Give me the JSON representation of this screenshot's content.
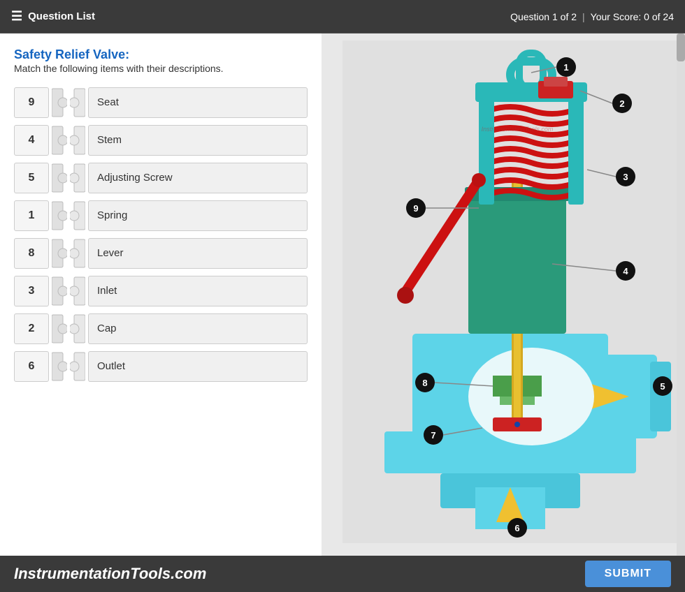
{
  "topBar": {
    "questionList": "Question List",
    "questionProgress": "Question 1 of 2",
    "score": "Your Score: 0 of 24"
  },
  "leftPanel": {
    "titleHighlight": "Safety Relief Valve:",
    "titleRest": "",
    "description": "Match the following items with their descriptions.",
    "rows": [
      {
        "number": "9",
        "label": "Seat"
      },
      {
        "number": "4",
        "label": "Stem"
      },
      {
        "number": "5",
        "label": "Adjusting Screw"
      },
      {
        "number": "1",
        "label": "Spring"
      },
      {
        "number": "8",
        "label": "Lever"
      },
      {
        "number": "3",
        "label": "Inlet"
      },
      {
        "number": "2",
        "label": "Cap"
      },
      {
        "number": "6",
        "label": "Outlet"
      }
    ]
  },
  "bottomBar": {
    "brand": "InstrumentationTools.com",
    "submitLabel": "SUBMIT"
  },
  "diagram": {
    "labels": [
      "1",
      "2",
      "3",
      "4",
      "5",
      "6",
      "7",
      "8",
      "9"
    ]
  }
}
